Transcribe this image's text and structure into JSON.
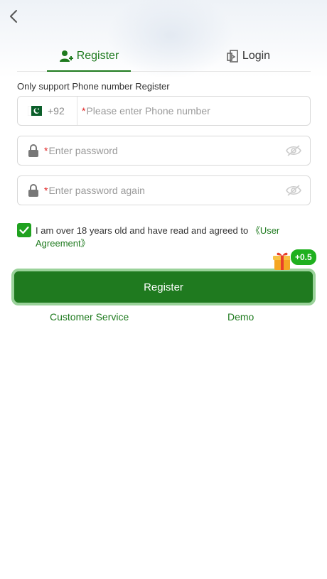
{
  "header": {
    "back_icon": "chevron-left-icon"
  },
  "tabs": [
    {
      "label": "Register",
      "icon": "user-plus-icon",
      "active": true
    },
    {
      "label": "Login",
      "icon": "door-exit-icon",
      "active": false
    }
  ],
  "form": {
    "note": "Only support Phone number Register",
    "phone": {
      "country_code": "+92",
      "flag": "pakistan-flag-icon",
      "required_mark": "*",
      "placeholder": "Please enter Phone number"
    },
    "password": {
      "required_mark": "*",
      "placeholder": "Enter password"
    },
    "password_again": {
      "required_mark": "*",
      "placeholder": "Enter password again"
    }
  },
  "agreement": {
    "checked": true,
    "text": "I am over 18 years old and have read and agreed to ",
    "link": "《User Agreement》"
  },
  "register_button": {
    "label": "Register",
    "bonus": "+0.5",
    "gift_icon": "gift-icon"
  },
  "footer_links": {
    "customer_service": "Customer Service",
    "demo": "Demo"
  },
  "colors": {
    "primary": "#1e7a1e",
    "checkbox": "#1fa11f",
    "required": "#e02020"
  }
}
